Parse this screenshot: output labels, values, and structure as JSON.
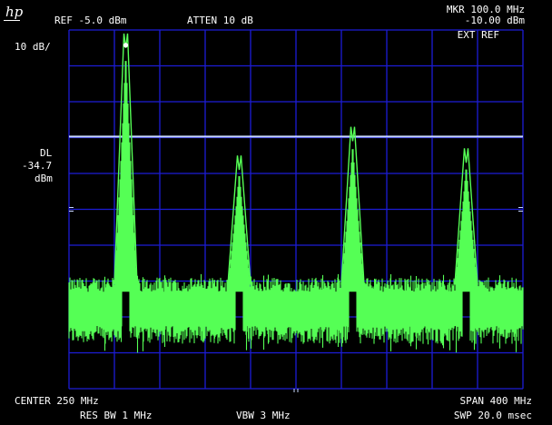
{
  "instrument": {
    "logo": "hp"
  },
  "header": {
    "ref_level": "REF -5.0 dBm",
    "attenuation": "ATTEN 10 dB",
    "marker_freq": "MKR 100.0 MHz",
    "marker_amp": "-10.00 dBm",
    "ext_ref": "EXT REF"
  },
  "left_panel": {
    "scale": "10 dB/",
    "display_line_label": "DL",
    "display_line_value": "-34.7",
    "display_line_unit": "dBm"
  },
  "footer": {
    "center": "CENTER 250 MHz",
    "span": "SPAN 400 MHz",
    "res_bw": "RES BW 1 MHz",
    "vbw": "VBW 3 MHz",
    "sweep": "SWP 20.0 msec"
  },
  "colors": {
    "background": "#000000",
    "grid": "#1c1cd6",
    "trace": "#55ff55",
    "display_line": "#c8d8ff",
    "text": "#ffffff"
  },
  "chart_data": {
    "type": "line",
    "xlabel": "",
    "ylabel": "",
    "x_range_mhz": [
      50,
      450
    ],
    "y_range_dbm": [
      -105,
      -5
    ],
    "grid": true,
    "reference_level_dbm": -5.0,
    "scale_db_per_div": 10,
    "display_line_dbm": -34.7,
    "noise_floor_dbm": [
      -76,
      -90
    ],
    "peaks": [
      {
        "freq_mhz": 100,
        "amp_dbm": -10.0
      },
      {
        "freq_mhz": 200,
        "amp_dbm": -44.0
      },
      {
        "freq_mhz": 300,
        "amp_dbm": -36.0
      },
      {
        "freq_mhz": 400,
        "amp_dbm": -42.0
      }
    ],
    "marker": {
      "freq_mhz": 100.0,
      "amp_dbm": -10.0
    }
  }
}
